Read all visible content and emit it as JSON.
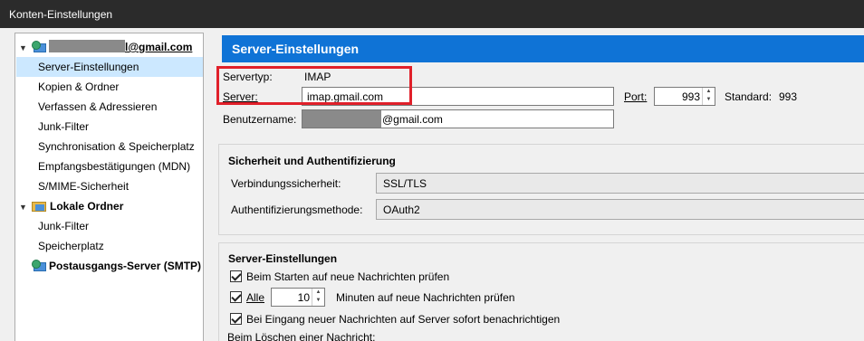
{
  "window": {
    "title": "Konten-Einstellungen"
  },
  "sidebar": {
    "account_email_suffix": "l@gmail.com",
    "items": [
      {
        "label": "Server-Einstellungen"
      },
      {
        "label": "Kopien & Ordner"
      },
      {
        "label": "Verfassen & Adressieren"
      },
      {
        "label": "Junk-Filter"
      },
      {
        "label": "Synchronisation & Speicherplatz"
      },
      {
        "label": "Empfangsbestätigungen (MDN)"
      },
      {
        "label": "S/MIME-Sicherheit"
      }
    ],
    "local_folders": {
      "label": "Lokale Ordner",
      "items": [
        {
          "label": "Junk-Filter"
        },
        {
          "label": "Speicherplatz"
        }
      ]
    },
    "smtp": {
      "label": "Postausgangs-Server (SMTP)"
    }
  },
  "main": {
    "title": "Server-Einstellungen",
    "server_type_label": "Servertyp:",
    "server_type_value": "IMAP",
    "server_label": "Server:",
    "server_value": "imap.gmail.com",
    "port_label": "Port:",
    "port_value": "993",
    "standard_label": "Standard:",
    "standard_value": "993",
    "username_label": "Benutzername:",
    "username_suffix": "@gmail.com",
    "security": {
      "title": "Sicherheit und Authentifizierung",
      "connection_label": "Verbindungssicherheit:",
      "connection_value": "SSL/TLS",
      "auth_label": "Authentifizierungsmethode:",
      "auth_value": "OAuth2"
    },
    "server_settings": {
      "title": "Server-Einstellungen",
      "check_on_start": "Beim Starten auf neue Nachrichten prüfen",
      "check_every_prefix": "Alle",
      "check_every_value": "10",
      "check_every_suffix": "Minuten auf neue Nachrichten prüfen",
      "notify_immediately": "Bei Eingang neuer Nachrichten auf Server sofort benachrichtigen",
      "on_delete_label": "Beim Löschen einer Nachricht:"
    }
  },
  "colors": {
    "header": "#0f73d6",
    "highlight": "#e0202a",
    "selected": "#cce8ff"
  }
}
